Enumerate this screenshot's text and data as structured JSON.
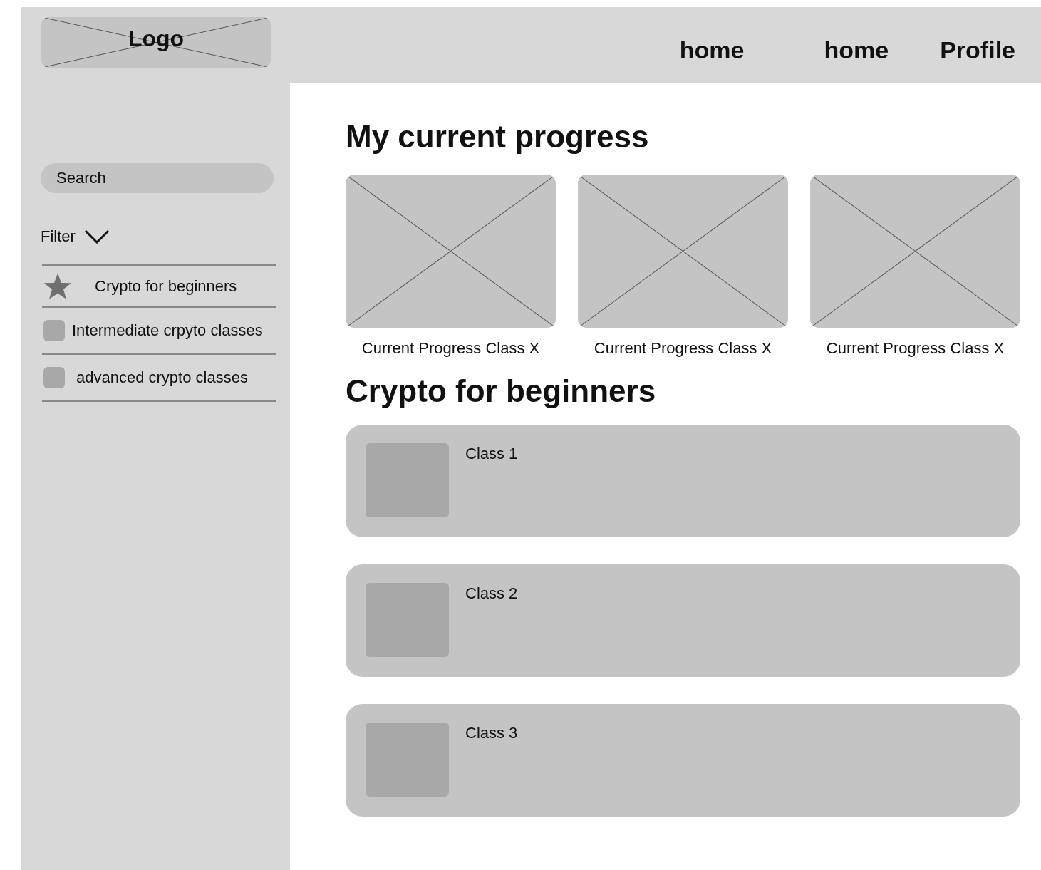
{
  "header": {
    "logo": "Logo",
    "nav": [
      {
        "label": "home"
      },
      {
        "label": "home"
      },
      {
        "label": "Profile"
      }
    ]
  },
  "sidebar": {
    "search": {
      "placeholder": "Search"
    },
    "filter": {
      "label": "Filter",
      "expanded": true
    },
    "items": [
      {
        "label": "Crypto for beginners",
        "selected": true
      },
      {
        "label": "Intermediate crpyto classes",
        "selected": false
      },
      {
        "label": "advanced crypto classes",
        "selected": false
      }
    ]
  },
  "progress": {
    "title": "My current progress",
    "cards": [
      {
        "caption": "Current Progress Class X"
      },
      {
        "caption": "Current Progress Class X"
      },
      {
        "caption": "Current Progress Class X"
      }
    ]
  },
  "section": {
    "title": "Crypto for beginners",
    "classes": [
      {
        "label": "Class 1"
      },
      {
        "label": "Class 2"
      },
      {
        "label": "Class 3"
      }
    ]
  }
}
